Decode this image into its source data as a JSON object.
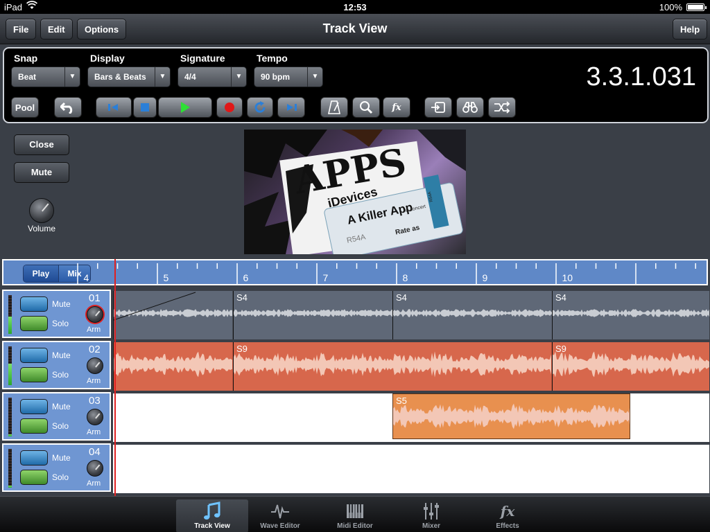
{
  "status": {
    "device": "iPad",
    "time": "12:53",
    "battery": "100%"
  },
  "nav": {
    "title": "Track View",
    "file": "File",
    "edit": "Edit",
    "options": "Options",
    "help": "Help"
  },
  "transport": {
    "snap_label": "Snap",
    "snap_value": "Beat",
    "display_label": "Display",
    "display_value": "Bars & Beats",
    "signature_label": "Signature",
    "signature_value": "4/4",
    "tempo_label": "Tempo",
    "tempo_value": "90 bpm",
    "position": "3.3.1.031",
    "pool": "Pool",
    "fx": "fx"
  },
  "side": {
    "close": "Close",
    "mute": "Mute",
    "volume": "Volume"
  },
  "artwork": {
    "line1": "APPS",
    "line2": "iDevices",
    "ticket_title": "A Killer App",
    "ticket_sub": "in concert",
    "seat": "R54A",
    "rate": "Rate as",
    "stub": "R54A"
  },
  "ruler": {
    "play": "Play",
    "mix": "Mix",
    "ticks": [
      "4",
      "5",
      "6",
      "7",
      "8",
      "9",
      "10"
    ]
  },
  "tracks": [
    {
      "num": "01",
      "mute": "Mute",
      "solo": "Solo",
      "arm": "Arm",
      "armed": true,
      "meter": 0.45,
      "clips": [
        {
          "name": ""
        },
        {
          "name": "S4"
        },
        {
          "name": "S4"
        },
        {
          "name": "S4"
        }
      ]
    },
    {
      "num": "02",
      "mute": "Mute",
      "solo": "Solo",
      "arm": "Arm",
      "armed": false,
      "meter": 0.55,
      "clips": [
        {
          "name": ""
        },
        {
          "name": "S9"
        },
        {
          "name": "S9"
        }
      ]
    },
    {
      "num": "03",
      "mute": "Mute",
      "solo": "Solo",
      "arm": "Arm",
      "armed": false,
      "meter": 0.05,
      "clips": [
        {
          "name": "S5"
        }
      ]
    },
    {
      "num": "04",
      "mute": "Mute",
      "solo": "Solo",
      "arm": "Arm",
      "armed": false,
      "meter": 0.05,
      "clips": []
    }
  ],
  "tabs": [
    {
      "label": "Track View",
      "icon": "music-note-icon",
      "active": true
    },
    {
      "label": "Wave Editor",
      "icon": "waveform-icon",
      "active": false
    },
    {
      "label": "Midi Editor",
      "icon": "piano-keys-icon",
      "active": false
    },
    {
      "label": "Mixer",
      "icon": "mixer-faders-icon",
      "active": false
    },
    {
      "label": "Effects",
      "icon": "fx-icon",
      "active": false
    }
  ],
  "colors": {
    "track1": "#5f6877",
    "track2": "#d7674c",
    "track3": "#e8904f",
    "ruler": "#5f88c7",
    "playhead": "#e02020"
  }
}
